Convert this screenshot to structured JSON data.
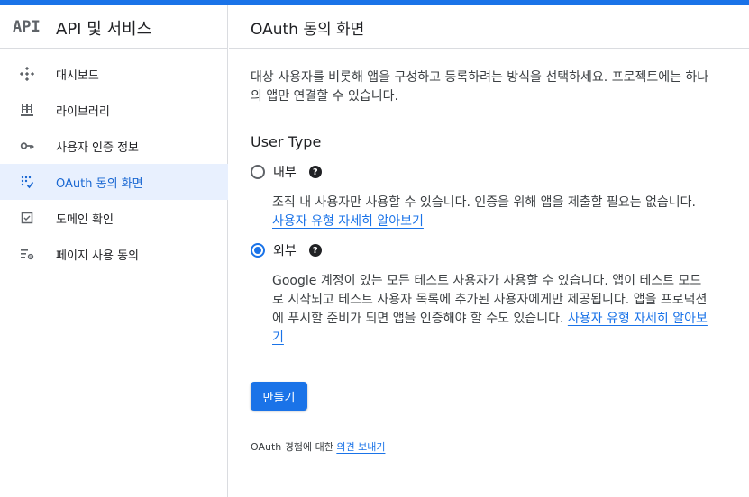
{
  "sidebar": {
    "logo": "API",
    "title": "API 및 서비스",
    "items": [
      {
        "label": "대시보드",
        "icon": "dashboard-icon"
      },
      {
        "label": "라이브러리",
        "icon": "library-icon"
      },
      {
        "label": "사용자 인증 정보",
        "icon": "key-icon"
      },
      {
        "label": "OAuth 동의 화면",
        "icon": "oauth-consent-icon",
        "active": true
      },
      {
        "label": "도메인 확인",
        "icon": "checkbox-icon"
      },
      {
        "label": "페이지 사용 동의",
        "icon": "settings-list-icon"
      }
    ]
  },
  "main": {
    "title": "OAuth 동의 화면",
    "intro": "대상 사용자를 비롯해 앱을 구성하고 등록하려는 방식을 선택하세요. 프로젝트에는 하나의 앱만 연결할 수 있습니다.",
    "user_type": {
      "heading": "User Type",
      "internal": {
        "label": "내부",
        "description": "조직 내 사용자만 사용할 수 있습니다. 인증을 위해 앱을 제출할 필요는 없습니다.",
        "link": "사용자 유형 자세히 알아보기",
        "selected": false
      },
      "external": {
        "label": "외부",
        "description": "Google 계정이 있는 모든 테스트 사용자가 사용할 수 있습니다. 앱이 테스트 모드로 시작되고 테스트 사용자 목록에 추가된 사용자에게만 제공됩니다. 앱을 프로덕션에 푸시할 준비가 되면 앱을 인증해야 할 수도 있습니다.",
        "link": "사용자 유형 자세히 알아보기",
        "selected": true
      }
    },
    "create_label": "만들기",
    "feedback_prefix": "OAuth 경험에 대한",
    "feedback_link": "의견 보내기"
  },
  "colors": {
    "accent": "#1a73e8",
    "active_bg": "#e8f0fe"
  }
}
